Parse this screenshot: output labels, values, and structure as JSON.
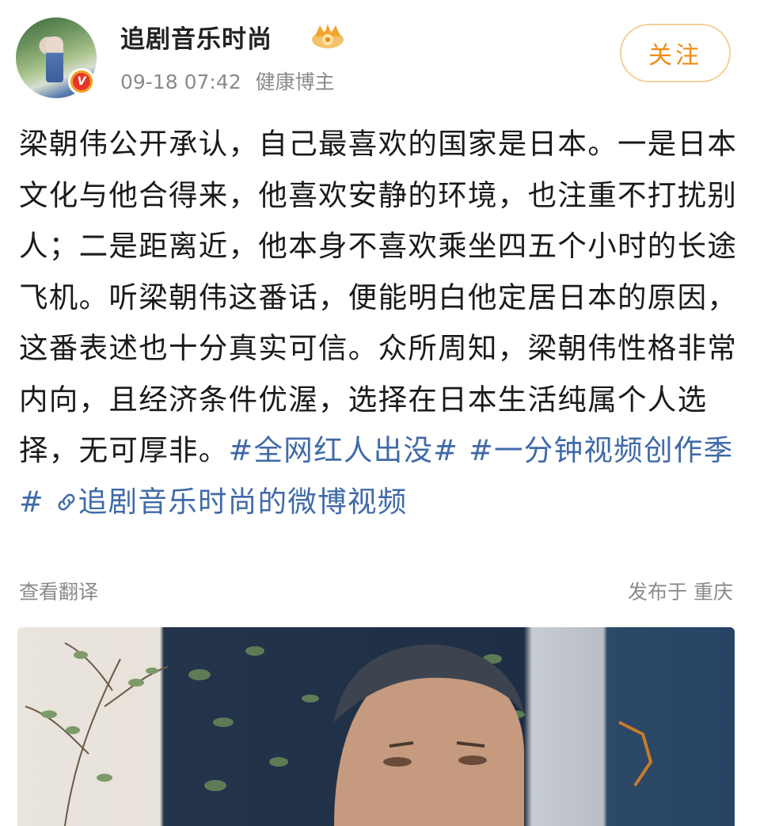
{
  "header": {
    "username": "追剧音乐时尚",
    "timestamp": "09-18 07:42",
    "tag": "健康博主",
    "verified_badge": "V",
    "follow_label": "关注",
    "accent_color": "#f08a16"
  },
  "post": {
    "text": "梁朝伟公开承认，自己最喜欢的国家是日本。一是日本文化与他合得来，他喜欢安静的环境，也注重不打扰别人；二是距离近，他本身不喜欢乘坐四五个小时的长途飞机。听梁朝伟这番话，便能明白他定居日本的原因，这番表述也十分真实可信。众所周知，梁朝伟性格非常内向，且经济条件优渥，选择在日本生活纯属个人选择，无可厚非。",
    "hashtag_1": "#全网红人出没#",
    "hashtag_2": "#一分钟视频创作季#",
    "link_icon": "link-icon",
    "link_text": "追剧音乐时尚的微博视频",
    "link_color": "#3f6aa8"
  },
  "footer": {
    "translate_label": "查看翻译",
    "location_label": "发布于 重庆"
  }
}
